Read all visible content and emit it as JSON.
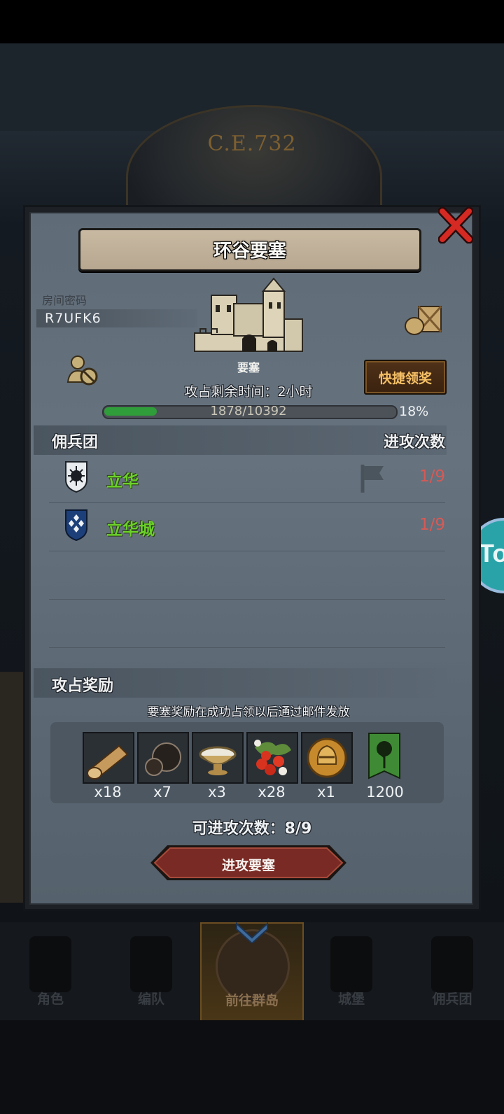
{
  "background": {
    "era_label": "C.E.732",
    "side_button_text": "To"
  },
  "dialog": {
    "title": "环谷要塞",
    "room_code_label": "房间密码",
    "room_code": "R7UFK6",
    "fortress_label": "要塞",
    "quick_claim_button": "快捷领奖",
    "capture_time_text": "攻占剩余时间：2小时",
    "progress": {
      "text": "1878/10392",
      "current": 1878,
      "total": 10392,
      "percent_text": "18%",
      "fill_color": "#2f9d3a"
    },
    "mercenary_section": {
      "title": "佣兵团",
      "attacks_header": "进攻次数",
      "rows": [
        {
          "name": "立华",
          "count": "1/9",
          "shield_icon": "white-shield-sun-icon"
        },
        {
          "name": "立华城",
          "count": "1/9",
          "shield_icon": "blue-shield-diamonds-icon"
        }
      ]
    },
    "reward_section": {
      "title": "攻占奖励",
      "note": "要塞奖励在成功占领以后通过邮件发放",
      "rewards": [
        {
          "icon": "wood-log-icon",
          "count": "x18"
        },
        {
          "icon": "truffle-icon",
          "count": "x7"
        },
        {
          "icon": "salt-bowl-icon",
          "count": "x3"
        },
        {
          "icon": "berries-icon",
          "count": "x28"
        },
        {
          "icon": "knight-helmet-coin-icon",
          "count": "x1"
        },
        {
          "icon": "green-tree-banner-icon",
          "count": "1200"
        }
      ]
    },
    "remaining_attacks_text": "可进攻次数：8/9",
    "attack_button": "进攻要塞"
  },
  "bottom_nav": {
    "items": [
      {
        "label": "角色"
      },
      {
        "label": "编队"
      },
      {
        "label": "前往群岛",
        "active": true
      },
      {
        "label": "城堡"
      },
      {
        "label": "佣兵团"
      }
    ]
  },
  "colors": {
    "guild_name": "#6bd12a",
    "attack_count": "#d75a55",
    "quick_button_text": "#f5c066"
  }
}
